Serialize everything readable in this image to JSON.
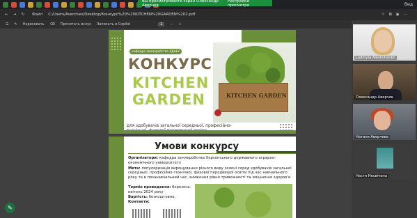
{
  "share_banner": {
    "message": "Вы просматриваете экран Олександр Аверчев",
    "settings": "Настройки просмотра"
  },
  "tabbar": {
    "right_label": "Вид"
  },
  "address": {
    "file_label": "Файл",
    "url": "C:/Users/Averchev/Desktop/Конкурс%20%20KITCHEN%20GARDEN%202.pdf"
  },
  "pdf_toolbar": {
    "draw": "Нарисовать",
    "read_aloud": "Прочитать вслух",
    "copilot": "Записать в Copilot",
    "page_indicator": "1"
  },
  "page1": {
    "tag": "кафедра землеробства ХДАЕУ",
    "title": "КОНКУРС",
    "kitchen": "KITCHEN",
    "garden": "GARDEN",
    "box_label": "KITCHEN GARDEN",
    "audience": "для здобувачів загальної середньої, професійно-технічної, фахової передвищої освіти"
  },
  "page2": {
    "title": "Умови конкурсу",
    "organizers_label": "Організатори:",
    "organizers_text": "кафедра землеробства Херсонського державного аграрно-економічного університету",
    "goal_label": "Мета:",
    "goal_text": "популяризація вирощування різного виду зелені серед здобувачів загальної середньої, професійно-технічної, фахової передвищої освіти під час навчального року та в позанавчальний час, зниження рівня тривожності та зміцнення здоров'я.",
    "term_label": "Термін проведення:",
    "term_text": "березень-квітень 2024 року",
    "cost_label": "Вартість:",
    "cost_text": "безкоштовно.",
    "contacts_label": "Контакти:"
  },
  "participants": [
    {
      "name": "Ludmyla Aleshchenko"
    },
    {
      "name": "Олександр Аверчев"
    },
    {
      "name": "Наталя Аверчева"
    },
    {
      "name": "Настя Несвічена"
    }
  ]
}
